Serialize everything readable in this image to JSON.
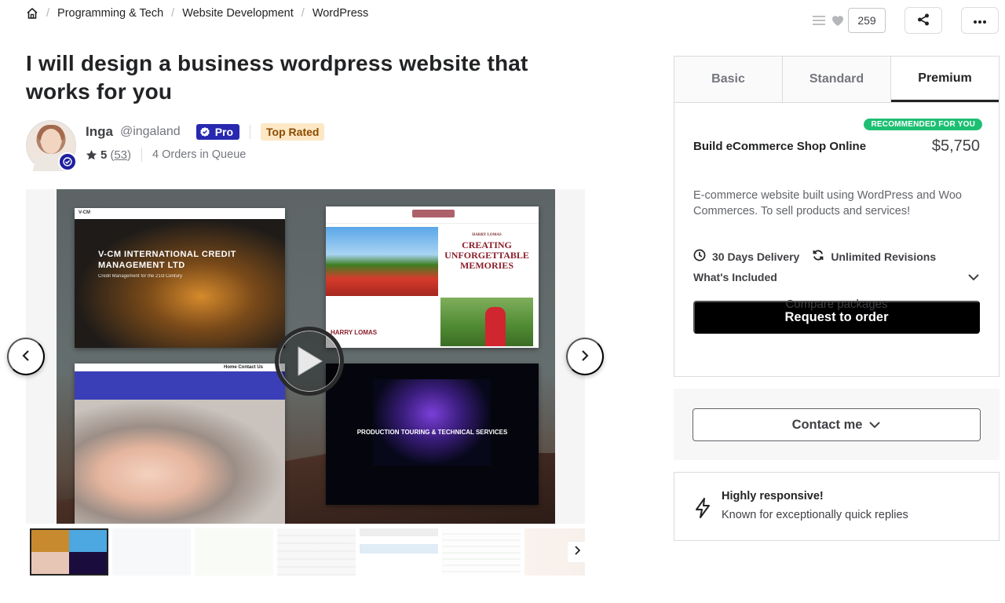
{
  "breadcrumb": {
    "items": [
      "Programming & Tech",
      "Website Development",
      "WordPress"
    ],
    "separator": "/"
  },
  "top_actions": {
    "save_count": "259"
  },
  "gig": {
    "title": "I will design a business wordpress website that works for you"
  },
  "seller": {
    "name": "Inga",
    "handle": "@ingaland",
    "pro_label": "Pro",
    "top_rated_label": "Top Rated",
    "rating": "5",
    "review_count": "53",
    "queue": "4 Orders in Queue"
  },
  "gallery": {
    "slide_1_title": "V-CM INTERNATIONAL CREDIT MANAGEMENT LTD",
    "slide_1_sub": "Credit Management for the 21st Century",
    "slide_1_nav": "V-CM",
    "slide_2_title": "CREATING UNFORGETTABLE MEMORIES",
    "slide_2_kicker": "HARRY LOMAS",
    "slide_2_name": "HARRY LOMAS",
    "slide_3_nav": "Home   Contact Us",
    "slide_4_title": "PRODUCTION TOURING & TECHNICAL SERVICES"
  },
  "packages": {
    "tabs": [
      "Basic",
      "Standard",
      "Premium"
    ],
    "active_tab": "Premium",
    "recommended_badge": "RECOMMENDED FOR YOU",
    "name": "Build eCommerce Shop Online",
    "price": "$5,750",
    "description": "E-commerce website built using WordPress and Woo Commerces. To sell products and services!",
    "delivery": "30 Days Delivery",
    "revisions": "Unlimited Revisions",
    "included_label": "What's Included",
    "order_button": "Request to order",
    "compare_link": "Compare packages"
  },
  "contact": {
    "button_label": "Contact me"
  },
  "responsive": {
    "title": "Highly responsive!",
    "subtitle": "Known for exceptionally quick replies"
  },
  "colors": {
    "pro_badge": "#2828b0",
    "recommended": "#1dbf73",
    "order_button": "#000000",
    "top_rated_bg": "#fde7c4"
  }
}
